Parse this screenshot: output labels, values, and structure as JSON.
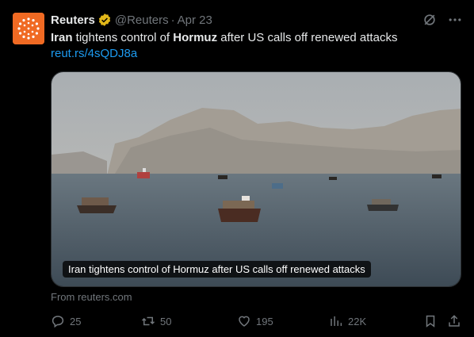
{
  "author": {
    "name": "Reuters",
    "handle": "@Reuters",
    "separator": "·",
    "date": "Apr 23"
  },
  "tweet": {
    "text_parts": [
      "Iran",
      " tightens control of ",
      "Hormuz",
      " after US calls off renewed attacks"
    ],
    "link": "reut.rs/4sQDJ8a"
  },
  "media": {
    "caption": "Iran tightens control of Hormuz after US calls off renewed attacks",
    "source": "From reuters.com"
  },
  "actions": {
    "replies": "25",
    "reposts": "50",
    "likes": "195",
    "views": "22K"
  },
  "colors": {
    "accent": "#1d9bf0",
    "brand": "#f06a23",
    "verified": "#e2b719",
    "muted": "#71767b"
  },
  "icons": [
    "reuters-logo",
    "verified-badge-icon",
    "grok-icon",
    "more-icon",
    "reply-icon",
    "repost-icon",
    "like-icon",
    "views-icon",
    "bookmark-icon",
    "share-icon"
  ]
}
